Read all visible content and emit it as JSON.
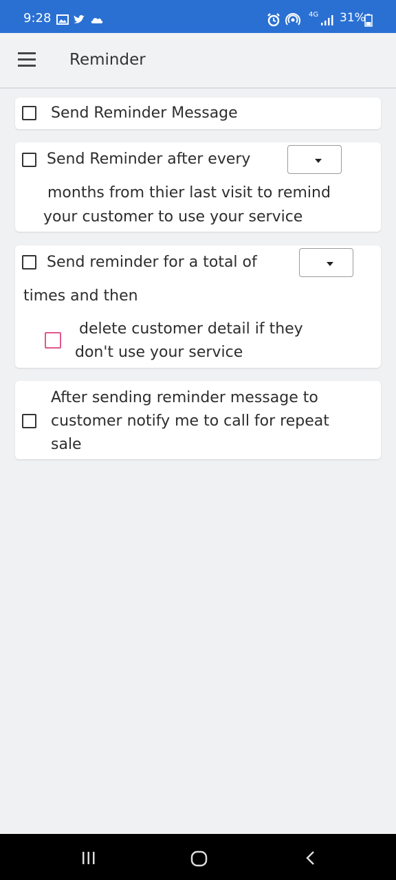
{
  "status_bar": {
    "time": "9:28",
    "network": "4G",
    "battery": "31%",
    "left_icons": [
      "image-icon",
      "twitter-icon",
      "cloud-icon"
    ],
    "right_icons": [
      "alarm-icon",
      "hotspot-icon",
      "signal-icon",
      "battery-icon"
    ]
  },
  "app_bar": {
    "title": "Reminder",
    "menu_icon": "hamburger-menu-icon"
  },
  "cards": {
    "send_message": {
      "label": "Send Reminder Message",
      "checked": false
    },
    "interval": {
      "label": "Send Reminder after every",
      "dropdown_value": "",
      "line2": "months from thier last visit to remind",
      "line3": "your customer to use your service",
      "checked": false
    },
    "total": {
      "label": "Send reminder for a total of",
      "dropdown_value": "",
      "line2": "times and then",
      "delete_line1": "delete customer detail if they",
      "delete_line2": "don't use your service",
      "checked": false,
      "delete_checked": false,
      "delete_checkbox_color": "#e0578a"
    },
    "notify": {
      "line1": "After sending reminder message to",
      "line2": "customer notify me to call for repeat",
      "line3": "sale",
      "checked": false
    }
  },
  "nav_bar": {
    "icons": [
      "recent-apps-icon",
      "home-icon",
      "back-icon"
    ]
  },
  "colors": {
    "status_bar": "#2a70d3",
    "background": "#f0f1f3",
    "card": "#ffffff"
  }
}
